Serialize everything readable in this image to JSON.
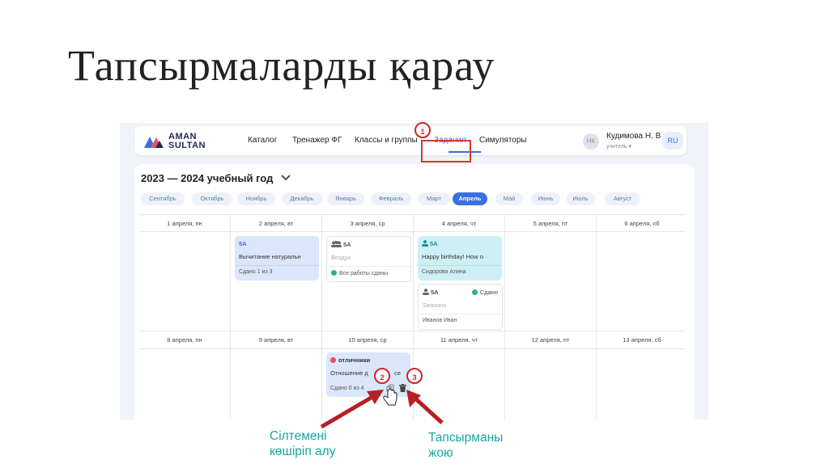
{
  "slide": {
    "title": "Тапсырмаларды қарау"
  },
  "header": {
    "logo": {
      "line1": "AMAN",
      "line2": "SULTAN"
    },
    "nav": [
      {
        "label": "Каталог"
      },
      {
        "label": "Тренажер ФГ"
      },
      {
        "label": "Классы и группы"
      },
      {
        "label": "Задания",
        "active": true
      },
      {
        "label": "Симуляторы"
      }
    ],
    "user": {
      "initials": "НК",
      "name": "Кудимова Н. В",
      "role": "учитель ▾"
    },
    "lang": "RU"
  },
  "calendar": {
    "year_label": "2023 — 2024 учебный год",
    "months": [
      "Сентябрь",
      "Октябрь",
      "Ноябрь",
      "Декабрь",
      "Январь",
      "Февраль",
      "Март",
      "Апрель",
      "Май",
      "Июнь",
      "Июль",
      "Август"
    ],
    "active_month": "Апрель",
    "week1": [
      "1 апреля, пн",
      "2 апреля, вт",
      "3 апреля, ср",
      "4 апреля, чт",
      "5 апреля, пт",
      "6 апреля, сб"
    ],
    "week2": [
      "8 апреля, пн",
      "9 апреля, вт",
      "10 апреля, ср",
      "11 апреля, чт",
      "12 апреля, пт",
      "13 апреля, сб"
    ],
    "cards": {
      "c1": {
        "class": "5А",
        "title": "Вычитание натуральн",
        "status": "Сдано 1 из 3"
      },
      "c2": {
        "class": "5А",
        "title": "Воздух",
        "status": "Все работы сданы"
      },
      "c3": {
        "class": "5А",
        "title": "Happy birthday! How o",
        "status": "Сидорова Алина"
      },
      "c4": {
        "class": "5А",
        "badge": "Сдано",
        "title": "Seasons",
        "status": "Иванов Иван"
      },
      "c5": {
        "class": "отличники",
        "title": "Отношение д",
        "title_tail": "се",
        "status": "Сдано 0 из 4"
      }
    }
  },
  "annotations": {
    "markers": [
      "1",
      "2",
      "3"
    ],
    "copy_link": {
      "line1": "Сілтемені",
      "line2": "көшіріп алу"
    },
    "delete_task": {
      "line1": "Тапсырманы",
      "line2": "жою"
    }
  },
  "colors": {
    "accent": "#3b6fe0",
    "annotation_red": "#c8262c",
    "annotation_teal": "#19a6a0"
  },
  "icons": [
    "group-icon",
    "user-icon",
    "check-circle-icon",
    "copy-link-icon",
    "trash-icon",
    "pointer-hand-icon",
    "chevron-down-icon"
  ]
}
